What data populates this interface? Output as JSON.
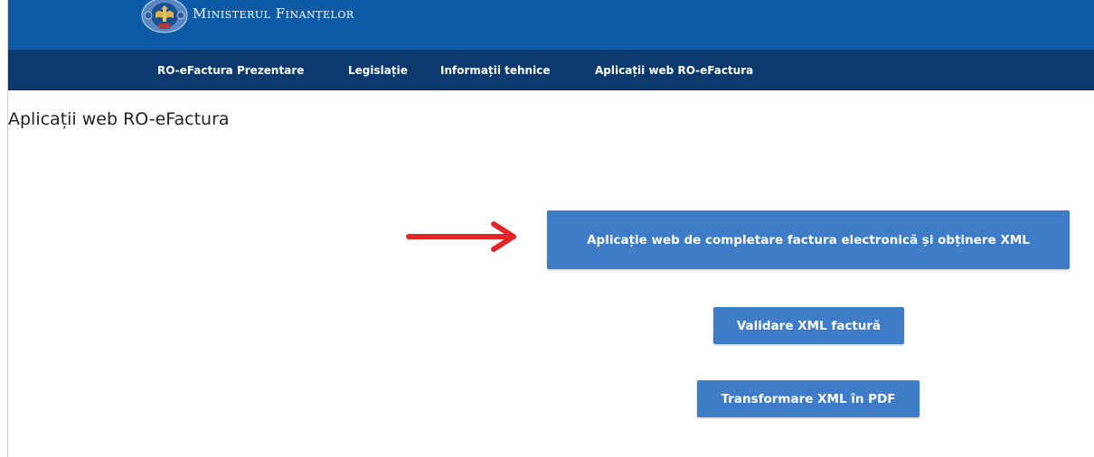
{
  "header": {
    "brand_name": "Ministerul Finanțelor",
    "crest_icon": "romania-coat-of-arms-icon",
    "bar_color": "#0d5aa7"
  },
  "nav": {
    "bar_color": "#0c3a6e",
    "items": [
      {
        "label": "RO-eFactura Prezentare"
      },
      {
        "label": "Legislație"
      },
      {
        "label": "Informații tehnice"
      },
      {
        "label": "Aplicații web RO-eFactura"
      }
    ]
  },
  "main": {
    "title": "Aplicații web RO-eFactura",
    "arrow_color": "#e32526",
    "button_color": "#3f7cc8",
    "buttons": {
      "primary": "Aplicație web de completare factura electronică și obținere XML",
      "validate": "Validare XML factură",
      "transform": "Transformare XML în PDF"
    }
  }
}
